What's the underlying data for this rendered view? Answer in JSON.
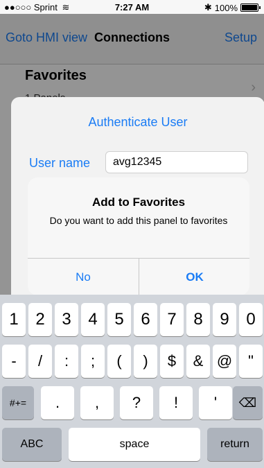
{
  "status_bar": {
    "signal_carrier": "●●○○○ Sprint",
    "wifi_icon": "wifi-icon",
    "time": "7:27 AM",
    "bluetooth_icon": "bluetooth-icon",
    "battery": "100%"
  },
  "nav": {
    "left": "Goto HMI view",
    "title": "Connections",
    "right": "Setup"
  },
  "content": {
    "favorites_title": "Favorites",
    "favorites_sub": "1 Panels"
  },
  "auth_dialog": {
    "title": "Authenticate User",
    "user_label": "User name",
    "user_value": "avg12345"
  },
  "alert": {
    "title": "Add to Favorites",
    "message": "Do you want to add this panel to favorites",
    "no_label": "No",
    "ok_label": "OK"
  },
  "keyboard": {
    "row1": [
      "1",
      "2",
      "3",
      "4",
      "5",
      "6",
      "7",
      "8",
      "9",
      "0"
    ],
    "row2": [
      "-",
      "/",
      ":",
      ";",
      "(",
      ")",
      "$",
      "&",
      "@",
      "\""
    ],
    "row3_left": "#+=",
    "row3": [
      ".",
      ",",
      "?",
      "!",
      "'"
    ],
    "row3_right_icon": "backspace-icon",
    "row4": {
      "left": "ABC",
      "space": "space",
      "return": "return"
    }
  },
  "colors": {
    "accent": "#1a7cf5",
    "keyboard_bg": "#d1d5db"
  }
}
